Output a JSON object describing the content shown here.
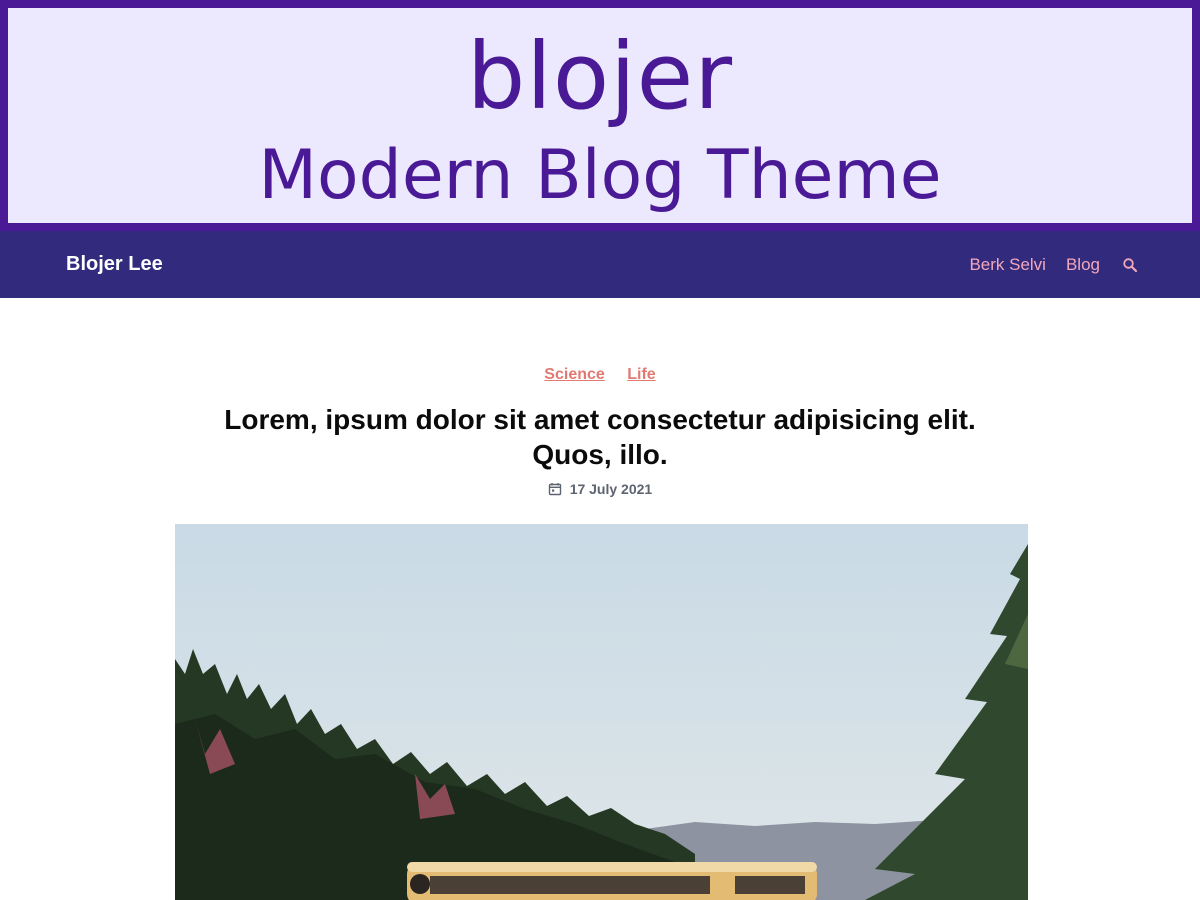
{
  "banner": {
    "title": "blojer",
    "subtitle": "Modern Blog Theme"
  },
  "navbar": {
    "brand": "Blojer Lee",
    "links": [
      "Berk Selvi",
      "Blog"
    ],
    "search_icon": "search-icon"
  },
  "post": {
    "categories": [
      "Science",
      "Life"
    ],
    "title": "Lorem, ipsum dolor sit amet consectetur adipisicing elit. Quos, illo.",
    "date": "17 July 2021",
    "date_icon": "calendar-icon",
    "image": "landscape photo with pine forest, mountains and a yellow school bus"
  },
  "colors": {
    "banner_border": "#4a1a96",
    "banner_bg": "#ece8fe",
    "navbar_bg": "#312a7d",
    "nav_link": "#f3a7bb",
    "category_link": "#e07a72"
  }
}
